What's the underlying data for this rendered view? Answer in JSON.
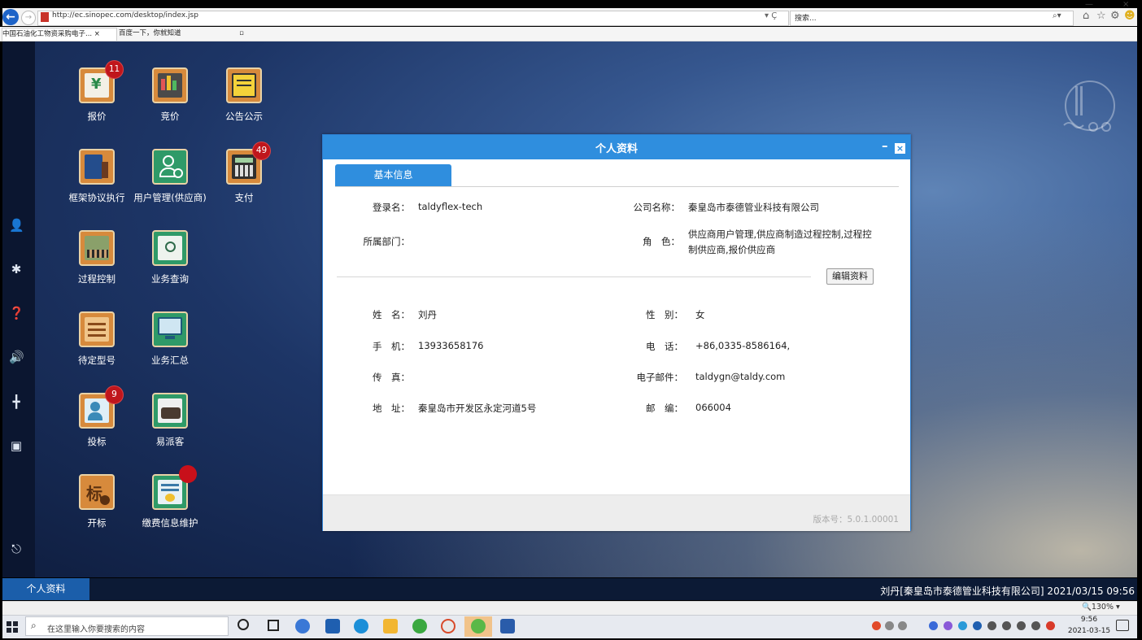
{
  "browser": {
    "url": "http://ec.sinopec.com/desktop/index.jsp",
    "url_actions": "▾ Ç",
    "search_placeholder": "搜索...",
    "tabs": [
      {
        "label": "中国石油化工物资采购电子...  ×"
      },
      {
        "label": "百度一下，你就知道"
      }
    ]
  },
  "desktop": {
    "apps": [
      {
        "label": "报价",
        "badge": "11"
      },
      {
        "label": "竞价"
      },
      {
        "label": "公告公示"
      },
      {
        "label": "框架协议执行"
      },
      {
        "label": "用户管理(供应商)"
      },
      {
        "label": "支付",
        "badge": "49"
      },
      {
        "label": "过程控制"
      },
      {
        "label": "业务查询"
      },
      {
        "label": "待定型号"
      },
      {
        "label": "业务汇总"
      },
      {
        "label": "投标",
        "badge": "9"
      },
      {
        "label": "易派客"
      },
      {
        "label": "开标"
      },
      {
        "label": "缴费信息维护"
      }
    ],
    "tile_glyphs": {
      "tender_open": "标",
      "quote": "¥"
    }
  },
  "dialog": {
    "title": "个人资料",
    "tab_label": "基本信息",
    "edit_button": "编辑资料",
    "version": "版本号：5.0.1.00001",
    "fields": {
      "login_name": {
        "label": "登录名：",
        "value": "taldyflex-tech"
      },
      "company": {
        "label": "公司名称：",
        "value": "秦皇岛市泰德管业科技有限公司"
      },
      "department": {
        "label": "所属部门：",
        "value": ""
      },
      "role": {
        "label": "角　色：",
        "value": "供应商用户管理,供应商制造过程控制,过程控制供应商,报价供应商"
      },
      "name": {
        "label": "姓　名：",
        "value": "刘丹"
      },
      "gender": {
        "label": "性　别：",
        "value": "女"
      },
      "mobile": {
        "label": "手　机：",
        "value": "13933658176"
      },
      "phone": {
        "label": "电　话：",
        "value": "+86,0335-8586164,"
      },
      "fax": {
        "label": "传　真：",
        "value": ""
      },
      "email": {
        "label": "电子邮件：",
        "value": "taldygn@taldy.com"
      },
      "address": {
        "label": "地　址：",
        "value": "秦皇岛市开发区永定河道5号"
      },
      "postcode": {
        "label": "邮　编：",
        "value": "066004"
      }
    }
  },
  "app_taskbar": {
    "active_tab": "个人资料",
    "user_status": "刘丹[秦皇岛市泰德管业科技有限公司]   2021/03/15   09:56"
  },
  "zoom": "🔍130%  ▾",
  "windows_taskbar": {
    "search_placeholder": "在这里输入你要搜索的内容",
    "time": "9:56",
    "date": "2021-03-15"
  },
  "colors": {
    "accent": "#2f8ede",
    "badge": "#c0161c",
    "tile_orange": "#d78a3c",
    "tile_green": "#2f9a68"
  }
}
